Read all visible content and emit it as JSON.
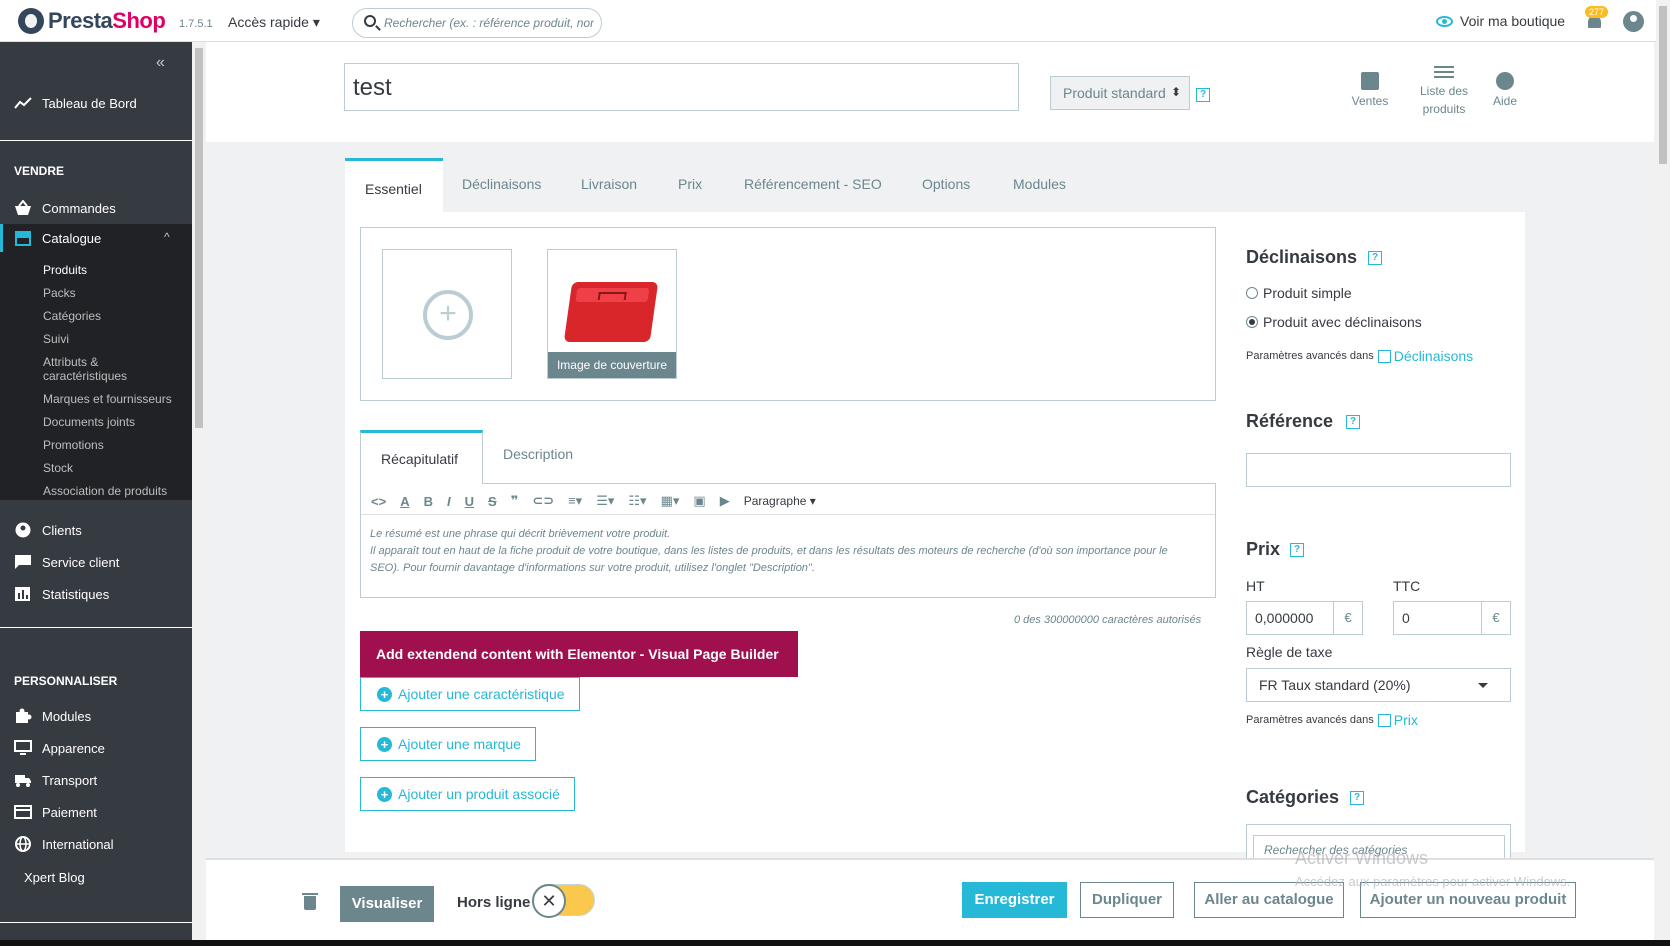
{
  "header": {
    "brand_part1": "Presta",
    "brand_part2": "Shop",
    "version": "1.7.5.1",
    "quick_access": "Accès rapide ▾",
    "search_placeholder": "Rechercher (ex. : référence produit, nom",
    "view_shop": "Voir ma boutique",
    "notifications_count": "277"
  },
  "sidebar": {
    "collapse": "«",
    "dashboard": "Tableau de Bord",
    "section_sell": "VENDRE",
    "orders": "Commandes",
    "catalog": "Catalogue",
    "catalog_chevron": "^",
    "catalog_sub": [
      "Produits",
      "Packs",
      "Catégories",
      "Suivi",
      "Attributs &",
      "caractéristiques",
      "Marques et fournisseurs",
      "Documents joints",
      "Promotions",
      "Stock",
      "Association de produits"
    ],
    "customers": "Clients",
    "customer_service": "Service client",
    "stats": "Statistiques",
    "section_customize": "PERSONNALISER",
    "modules": "Modules",
    "appearance": "Apparence",
    "shipping": "Transport",
    "payment": "Paiement",
    "international": "International",
    "blog": "Xpert Blog"
  },
  "product": {
    "name": "test",
    "type": "Produit standard",
    "help": "?",
    "tools": {
      "sales": "Ventes",
      "list_line1": "Liste des",
      "list_line2": "produits",
      "help": "Aide"
    }
  },
  "tabs": [
    "Essentiel",
    "Déclinaisons",
    "Livraison",
    "Prix",
    "Référencement - SEO",
    "Options",
    "Modules"
  ],
  "images": {
    "add": "+",
    "cover_label": "Image de couverture"
  },
  "description": {
    "tab_summary": "Récapitulatif",
    "tab_description": "Description",
    "toolbar_paragraph": "Paragraphe ▾",
    "text_line1": "Le résumé est une phrase qui décrit brièvement votre produit.",
    "text_line2": "Il apparaît tout en haut de la fiche produit de votre boutique, dans les listes de produits, et dans les résultats des moteurs de recherche (d'où son importance pour le SEO). Pour fournir davantage d'informations sur votre produit, utilisez l'onglet \"Description\".",
    "counter": "0 des 300000000 caractères autorisés"
  },
  "actions": {
    "elementor": "Add extendend content with Elementor - Visual Page Builder",
    "add_feature": "Ajouter une caractéristique",
    "add_brand": "Ajouter une marque",
    "add_related": "Ajouter un produit associé"
  },
  "right": {
    "combinations_title": "Déclinaisons",
    "simple_product": "Produit simple",
    "with_combinations": "Produit avec déclinaisons",
    "advanced_in": "Paramètres avancés dans",
    "combinations_link": "Déclinaisons",
    "reference_title": "Référence",
    "price_title": "Prix",
    "ht_label": "HT",
    "ttc_label": "TTC",
    "ht_value": "0,000000",
    "ttc_value": "0",
    "currency": "€",
    "tax_label": "Règle de taxe",
    "tax_value": "FR Taux standard (20%)",
    "price_link": "Prix",
    "categories_title": "Catégories",
    "category_search_placeholder": "Rechercher des catégories"
  },
  "footer": {
    "preview": "Visualiser",
    "offline": "Hors ligne",
    "toggle": "✕",
    "save": "Enregistrer",
    "duplicate": "Dupliquer",
    "go_catalog": "Aller au catalogue",
    "add_new": "Ajouter un nouveau produit"
  },
  "watermark": {
    "line1": "Activer Windows",
    "line2": "Accédez aux paramètres pour activer Windows."
  },
  "colors": {
    "accent": "#25b9d7",
    "sidebar": "#363a41",
    "elementor": "#a0104f",
    "toggle": "#fbbb22"
  }
}
